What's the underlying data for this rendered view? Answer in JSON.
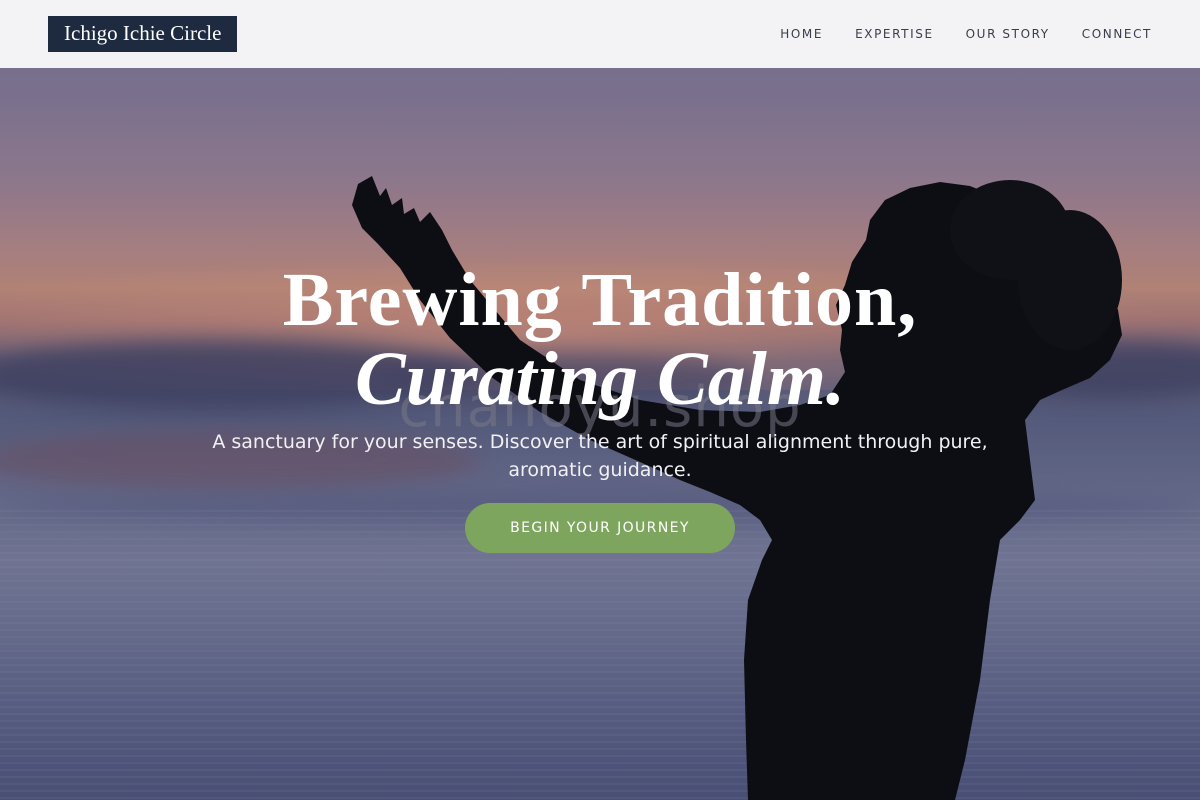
{
  "header": {
    "logo": "Ichigo Ichie Circle",
    "nav": [
      {
        "label": "HOME"
      },
      {
        "label": "EXPERTISE"
      },
      {
        "label": "OUR STORY"
      },
      {
        "label": "CONNECT"
      }
    ]
  },
  "hero": {
    "title_line1": "Brewing Tradition,",
    "title_line2": "Curating Calm.",
    "watermark": "chanoyu.shop",
    "subtitle": "A sanctuary for your senses. Discover the art of spiritual alignment through pure, aromatic guidance.",
    "cta_label": "BEGIN YOUR JOURNEY"
  },
  "colors": {
    "header_bg": "#f3f3f5",
    "logo_bg": "#1e2a40",
    "cta_bg": "#7ea55e"
  }
}
